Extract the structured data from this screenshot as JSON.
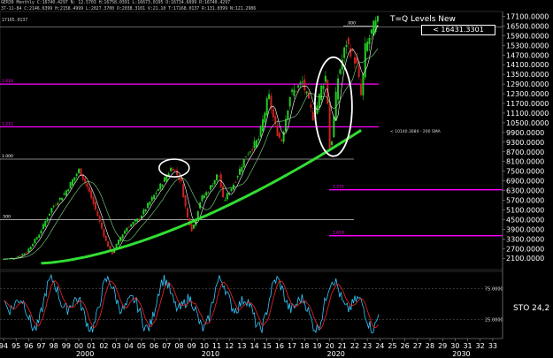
{
  "header": {
    "line1": "GER30 Monthly  C:16740.4297  N:  12.5703  H:16758.0391  L:16673.0195  O:16734.6699  R:16740.4297",
    "line2": "37-11-84  C:2146.6399  H:2158.4999  L:2027.3700  O:2038.3101  V:21.10  T:17168.0137  R:131.0399  N:121.2986",
    "line3": "17165.0137"
  },
  "title": "T=Q Levels New",
  "price_box": "< 16431.3301",
  "sma_label": "<  10140.3084 - 200 SMA",
  "sto_label": "STO  24,2",
  "chart_data": {
    "type": "line",
    "ylim": [
      1400,
      17400
    ],
    "price_axis_ticks": [
      "17100.0000",
      "16500.0000",
      "15900.0000",
      "15300.0000",
      "14700.0000",
      "14100.0000",
      "13500.0000",
      "12900.0000",
      "12300.0000",
      "11700.0000",
      "11100.0000",
      "10500.0000",
      "9900.0000",
      "9300.0000",
      "8700.0000",
      "8100.0000",
      "7500.0000",
      "6900.0000",
      "6300.0000",
      "5700.0000",
      "5100.0000",
      "4500.0000",
      "3900.0000",
      "3300.0000",
      "2700.0000",
      "2100.0000"
    ],
    "x_ticks": [
      "94",
      "95",
      "96",
      "97",
      "98",
      "99",
      "00",
      "01",
      "02",
      "03",
      "04",
      "05",
      "06",
      "07",
      "08",
      "09",
      "10",
      "11",
      "12",
      "13",
      "14",
      "15",
      "16",
      "17",
      "18",
      "19",
      "20",
      "21",
      "22",
      "23",
      "24",
      "25",
      "26",
      "27",
      "28",
      "29",
      "30",
      "31",
      "32",
      "33"
    ],
    "decade_labels": [
      "2000",
      "2010",
      "2020",
      "2030"
    ],
    "price_points": [
      [
        1994,
        2050
      ],
      [
        1995,
        2100
      ],
      [
        1996,
        2500
      ],
      [
        1997,
        3600
      ],
      [
        1998,
        5200
      ],
      [
        1999,
        6100
      ],
      [
        2000.2,
        7600
      ],
      [
        2000.9,
        6400
      ],
      [
        2001.6,
        4900
      ],
      [
        2002.3,
        3200
      ],
      [
        2002.8,
        2350
      ],
      [
        2003.4,
        3300
      ],
      [
        2004,
        4000
      ],
      [
        2005,
        4600
      ],
      [
        2006,
        5800
      ],
      [
        2007,
        7000
      ],
      [
        2007.6,
        7800
      ],
      [
        2008.3,
        6900
      ],
      [
        2008.8,
        4700
      ],
      [
        2009.2,
        3800
      ],
      [
        2009.9,
        5800
      ],
      [
        2010.5,
        6300
      ],
      [
        2011.3,
        7400
      ],
      [
        2011.7,
        5600
      ],
      [
        2012.5,
        6700
      ],
      [
        2013.5,
        8500
      ],
      [
        2014.5,
        9500
      ],
      [
        2015.3,
        12200
      ],
      [
        2015.8,
        10300
      ],
      [
        2016.3,
        9300
      ],
      [
        2017,
        12200
      ],
      [
        2018,
        13000
      ],
      [
        2018.9,
        10700
      ],
      [
        2019.5,
        12700
      ],
      [
        2019.9,
        13500
      ],
      [
        2020.2,
        8400
      ],
      [
        2020.8,
        13200
      ],
      [
        2021.5,
        15500
      ],
      [
        2022.3,
        14200
      ],
      [
        2022.7,
        12000
      ],
      [
        2023,
        15100
      ],
      [
        2023.7,
        16500
      ],
      [
        2024,
        16740
      ]
    ],
    "sma_label_value": 10140.3084,
    "levels": [
      {
        "label": "1.618",
        "value": 12900,
        "color": "#ff00ff"
      },
      {
        "label": "1.272",
        "value": 10250,
        "color": "#ff00ff"
      },
      {
        "label": "1.000",
        "value": 8250,
        "color": "#ffffff"
      },
      {
        "label": ".500",
        "value": 4500,
        "color": "#ffffff"
      },
      {
        "label": "1.272",
        "value": 6350,
        "color": "#ff00ff"
      },
      {
        "label": "1.618",
        "value": 3500,
        "color": "#ff00ff"
      },
      {
        "label": ".000",
        "value": 16500,
        "color": "#ffffff"
      }
    ],
    "sto_ticks": [
      "25.0000",
      "75.0000"
    ],
    "sto_value": 24.2
  },
  "colors": {
    "background": "#000000",
    "up_candle": "#22cc22",
    "down_candle": "#cc2222",
    "sma200": "#33dd33",
    "level_magenta": "#ff00ff",
    "sto_blue": "#33c8ff",
    "sto_red": "#dd2222",
    "circle": "#ffffff"
  }
}
